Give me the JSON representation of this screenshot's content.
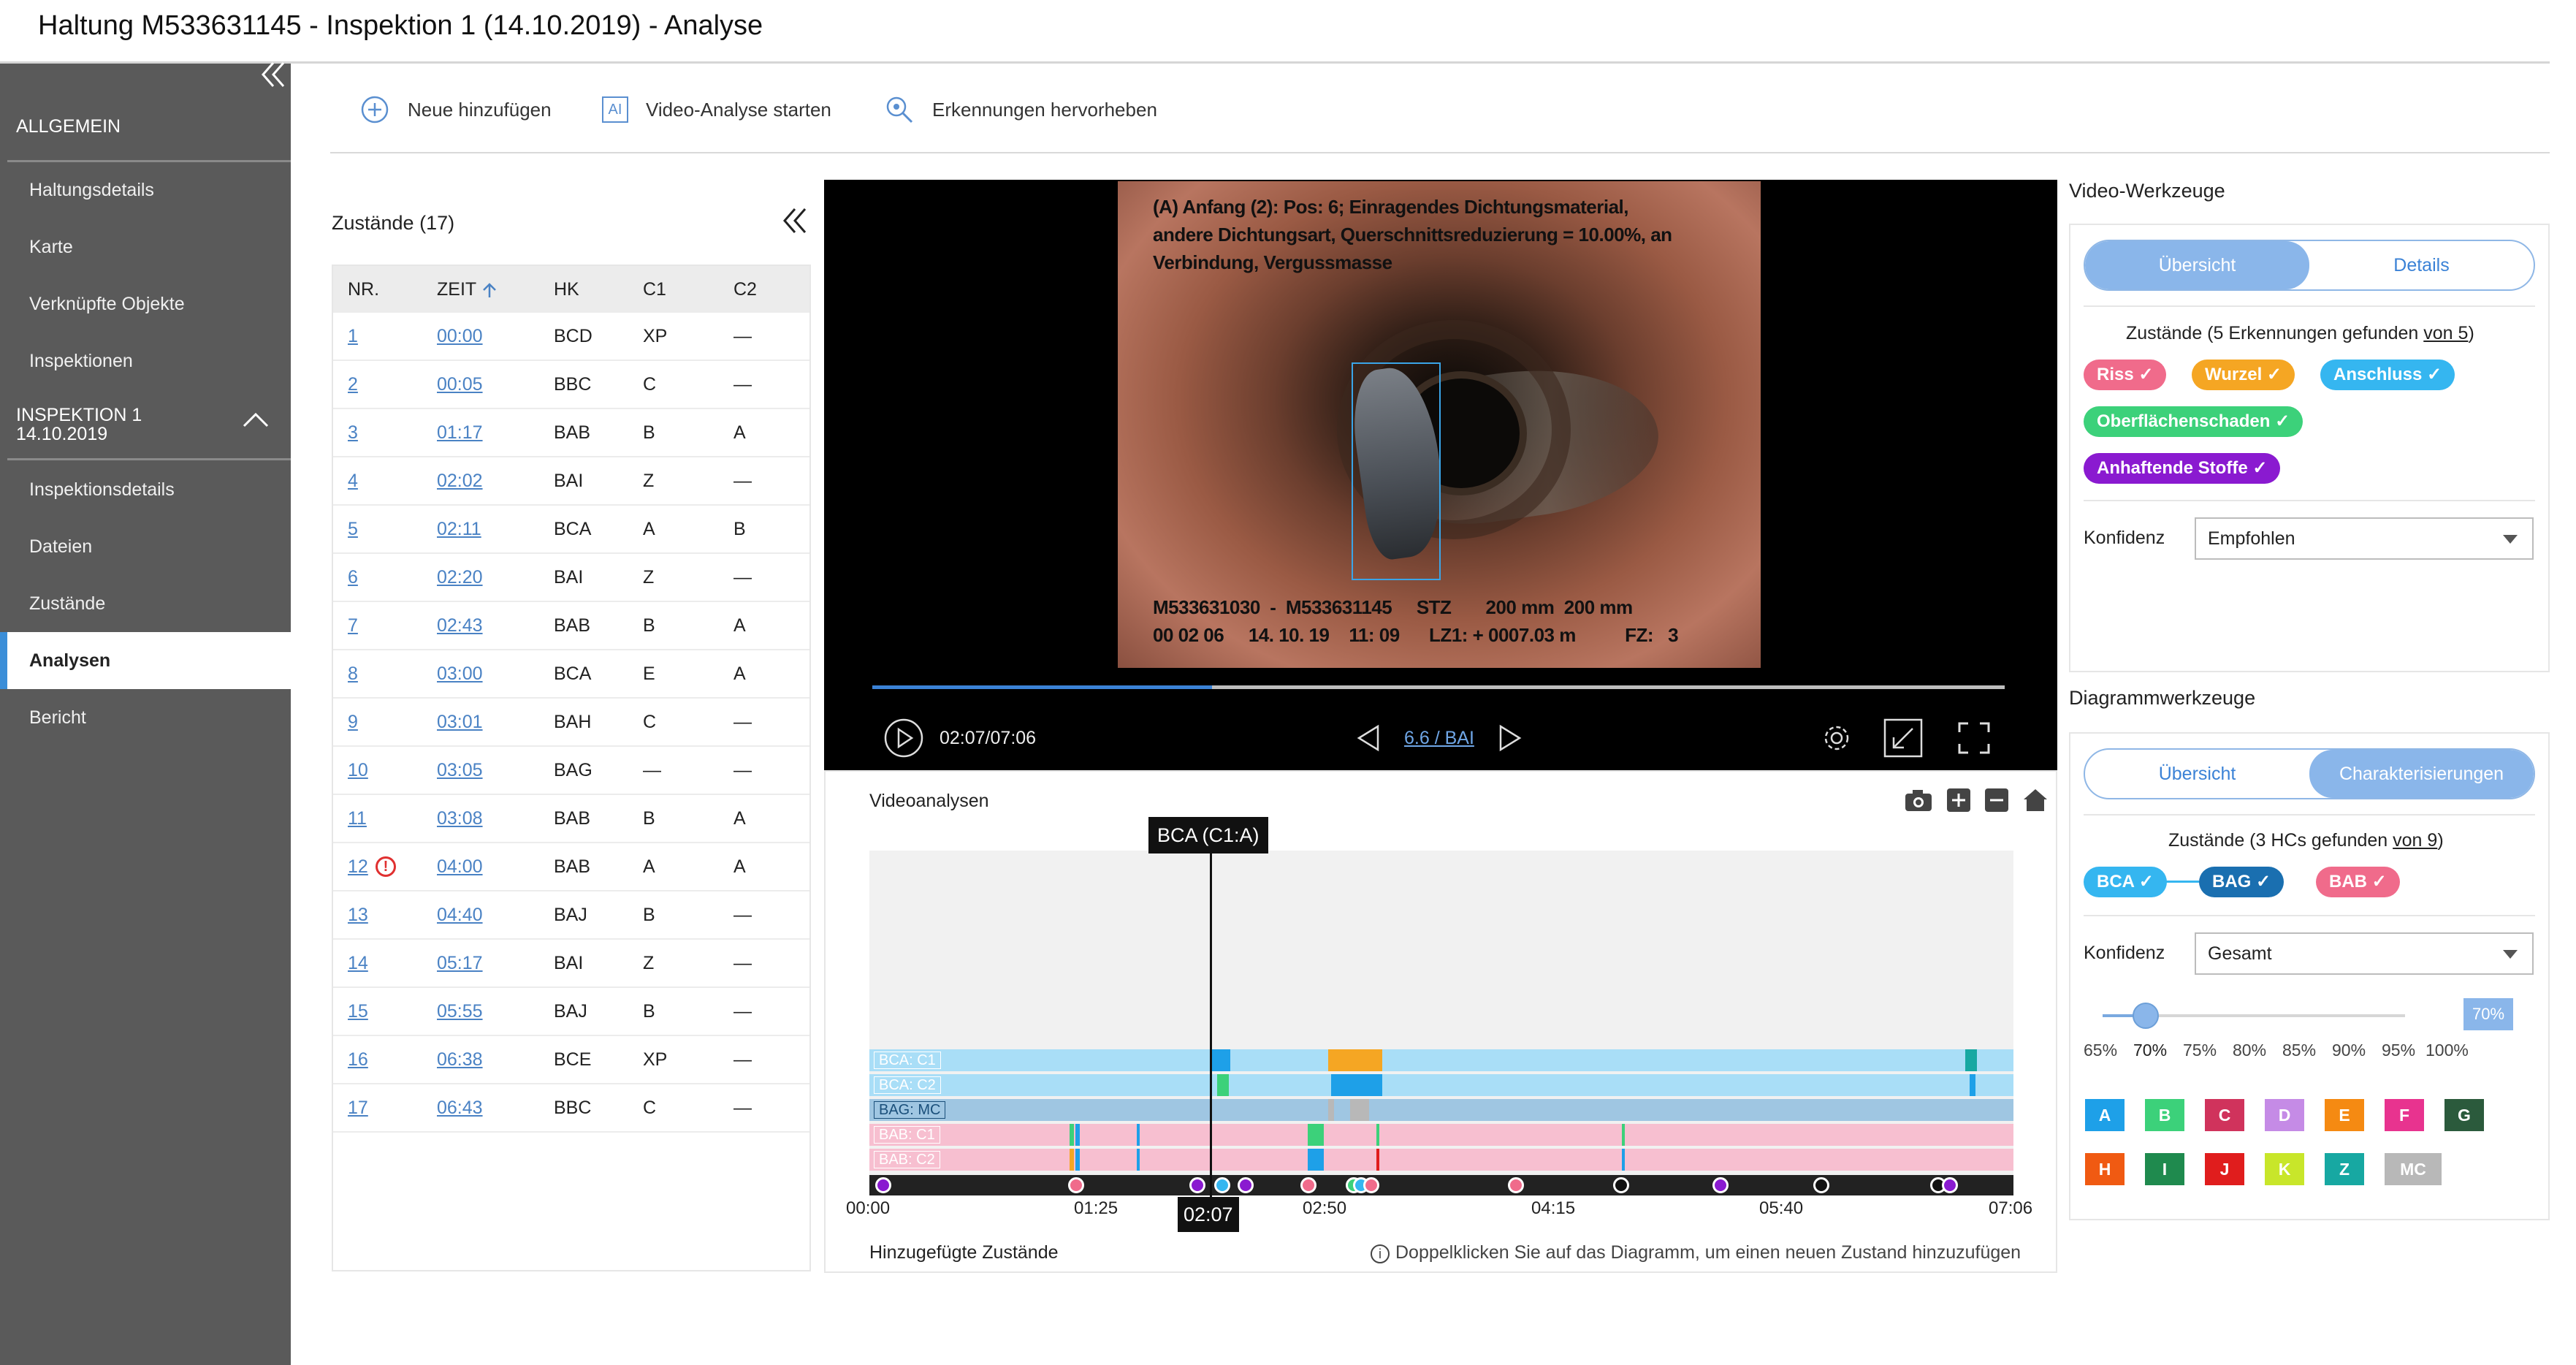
{
  "window": {
    "title": "Haltung M533631145 - Inspektion 1 (14.10.2019) - Analyse"
  },
  "sidebar": {
    "section_general": "ALLGEMEIN",
    "items_general": [
      "Haltungsdetails",
      "Karte",
      "Verknüpfte Objekte",
      "Inspektionen"
    ],
    "section_inspection_line1": "INSPEKTION 1",
    "section_inspection_line2": "14.10.2019",
    "items_inspection": [
      "Inspektionsdetails",
      "Dateien",
      "Zustände",
      "Analysen",
      "Bericht"
    ],
    "active_item": "Analysen"
  },
  "toolbar": {
    "add_label": "Neue hinzufügen",
    "ai_icon_text": "AI",
    "analysis_label": "Video-Analyse starten",
    "highlight_label": "Erkennungen hervorheben"
  },
  "zustaende": {
    "title": "Zustände (17)",
    "headers": [
      "NR.",
      "ZEIT",
      "HK",
      "C1",
      "C2"
    ],
    "rows": [
      {
        "nr": "1",
        "zeit": "00:00",
        "hk": "BCD",
        "c1": "XP",
        "c2": "—"
      },
      {
        "nr": "2",
        "zeit": "00:05",
        "hk": "BBC",
        "c1": "C",
        "c2": "—"
      },
      {
        "nr": "3",
        "zeit": "01:17",
        "hk": "BAB",
        "c1": "B",
        "c2": "A"
      },
      {
        "nr": "4",
        "zeit": "02:02",
        "hk": "BAI",
        "c1": "Z",
        "c2": "—"
      },
      {
        "nr": "5",
        "zeit": "02:11",
        "hk": "BCA",
        "c1": "A",
        "c2": "B"
      },
      {
        "nr": "6",
        "zeit": "02:20",
        "hk": "BAI",
        "c1": "Z",
        "c2": "—"
      },
      {
        "nr": "7",
        "zeit": "02:43",
        "hk": "BAB",
        "c1": "B",
        "c2": "A"
      },
      {
        "nr": "8",
        "zeit": "03:00",
        "hk": "BCA",
        "c1": "E",
        "c2": "A"
      },
      {
        "nr": "9",
        "zeit": "03:01",
        "hk": "BAH",
        "c1": "C",
        "c2": "—"
      },
      {
        "nr": "10",
        "zeit": "03:05",
        "hk": "BAG",
        "c1": "—",
        "c2": "—"
      },
      {
        "nr": "11",
        "zeit": "03:08",
        "hk": "BAB",
        "c1": "B",
        "c2": "A"
      },
      {
        "nr": "12",
        "zeit": "04:00",
        "hk": "BAB",
        "c1": "A",
        "c2": "A"
      },
      {
        "nr": "13",
        "zeit": "04:40",
        "hk": "BAJ",
        "c1": "B",
        "c2": "—"
      },
      {
        "nr": "14",
        "zeit": "05:17",
        "hk": "BAI",
        "c1": "Z",
        "c2": "—"
      },
      {
        "nr": "15",
        "zeit": "05:55",
        "hk": "BAJ",
        "c1": "B",
        "c2": "—"
      },
      {
        "nr": "16",
        "zeit": "06:38",
        "hk": "BCE",
        "c1": "XP",
        "c2": "—"
      },
      {
        "nr": "17",
        "zeit": "06:43",
        "hk": "BBC",
        "c1": "C",
        "c2": "—"
      }
    ],
    "warning_row": "12",
    "warning_glyph": "!"
  },
  "video": {
    "overlay_line1": "(A) Anfang (2): Pos: 6; Einragendes Dichtungsmaterial,",
    "overlay_line2": "andere Dichtungsart, Querschnittsreduzierung = 10.00%, an",
    "overlay_line3": "Verbindung, Vergussmasse",
    "overlay_bottom1": "M533631030  -  M533631145     STZ       200 mm  200 mm",
    "overlay_bottom2": "00 02 06     14. 10. 19    11: 09      LZ1: + 0007.03 m          FZ:   3",
    "time": "02:07/07:06",
    "nav_label": "6.6 / BAI",
    "progress_fraction": 0.3
  },
  "timeline": {
    "title": "Videoanalysen",
    "cursor_label": "BCA (C1:A)",
    "cursor_time": "02:07",
    "lanes": [
      "BCA: C1",
      "BCA: C2",
      "BAG: MC",
      "BAB: C1",
      "BAB: C2"
    ],
    "ticks": [
      "00:00",
      "01:25",
      "02:50",
      "04:15",
      "05:40",
      "07:06"
    ],
    "added_title": "Hinzugefügte Zustände",
    "hint": "Doppelklicken Sie auf das Diagramm, um einen neuen Zustand hinzuzufügen",
    "info_glyph": "i"
  },
  "video_tools": {
    "title": "Video-Werkzeuge",
    "tab_overview": "Übersicht",
    "tab_details": "Details",
    "status_prefix": "Zustände (5 Erkennungen gefunden ",
    "status_link": "von 5",
    "status_suffix": ")",
    "chips": [
      {
        "label": "Riss ✓",
        "color": "#f06b8b"
      },
      {
        "label": "Wurzel ✓",
        "color": "#f5a623"
      },
      {
        "label": "Anschluss ✓",
        "color": "#35b6f0"
      },
      {
        "label": "Oberflächenschaden ✓",
        "color": "#3cd17a"
      },
      {
        "label": "Anhaftende Stoffe ✓",
        "color": "#8a1ad0"
      }
    ],
    "konfidenz_label": "Konfidenz",
    "konfidenz_value": "Empfohlen"
  },
  "diagram_tools": {
    "title": "Diagrammwerkzeuge",
    "tab_overview": "Übersicht",
    "tab_char": "Charakterisierungen",
    "status_prefix": "Zustände (3 HCs gefunden ",
    "status_link": "von 9",
    "status_suffix": ")",
    "chips": [
      {
        "label": "BCA ✓",
        "color": "#35b6f0"
      },
      {
        "label": "BAG ✓",
        "color": "#1a6fb0"
      },
      {
        "label": "BAB ✓",
        "color": "#f06b8b"
      }
    ],
    "konfidenz_label": "Konfidenz",
    "konfidenz_value": "Gesamt",
    "slider_value": "70%",
    "slider_fraction": 0.143,
    "percent_labels": [
      "65%",
      "70%",
      "75%",
      "80%",
      "85%",
      "90%",
      "95%",
      "100%"
    ],
    "class_swatches": [
      {
        "label": "A",
        "color": "#1ea0e8"
      },
      {
        "label": "B",
        "color": "#3cd17a"
      },
      {
        "label": "C",
        "color": "#d0335c"
      },
      {
        "label": "D",
        "color": "#c58be6"
      },
      {
        "label": "E",
        "color": "#f58a12"
      },
      {
        "label": "F",
        "color": "#e8338f"
      },
      {
        "label": "G",
        "color": "#2b5a3c"
      },
      {
        "label": "H",
        "color": "#f05a12"
      },
      {
        "label": "I",
        "color": "#1f8a4e"
      },
      {
        "label": "J",
        "color": "#e01d1d"
      },
      {
        "label": "K",
        "color": "#c8e62a"
      },
      {
        "label": "Z",
        "color": "#17a8a2"
      },
      {
        "label": "MC",
        "color": "#b8b8b8"
      }
    ]
  }
}
